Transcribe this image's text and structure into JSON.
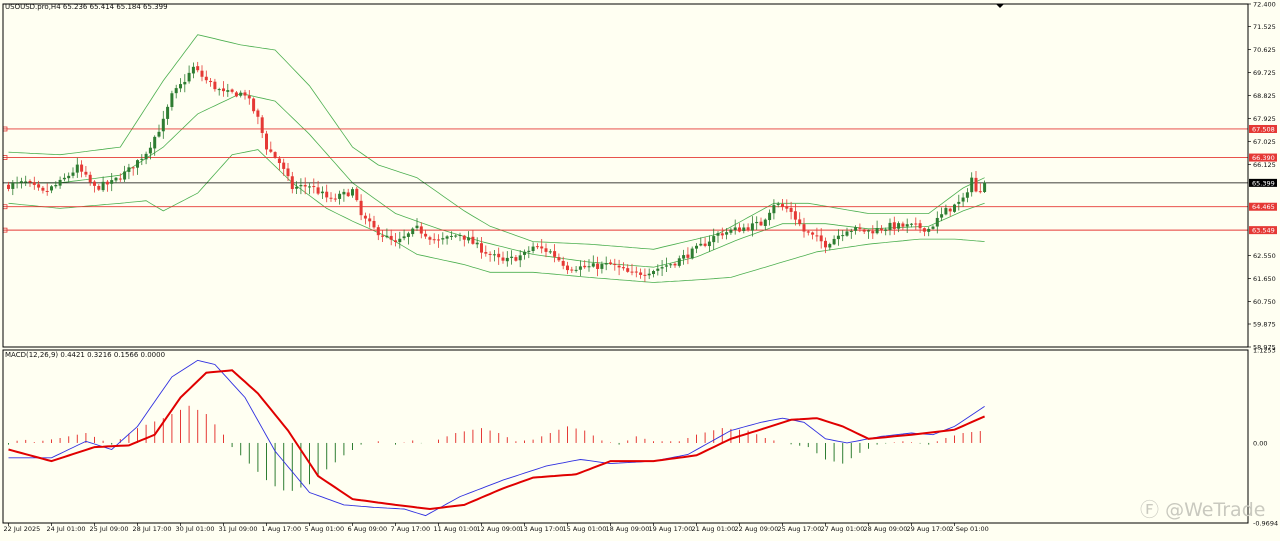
{
  "chart_data": [
    {
      "type": "candlestick",
      "title": "USOUSD.pro,H4",
      "ohlc_readout": "65.236 65.414 65.184 65.399",
      "ylim": [
        58.975,
        72.4
      ],
      "price_ticks": [
        "72.400",
        "71.525",
        "70.625",
        "69.725",
        "68.825",
        "67.925",
        "67.025",
        "66.125",
        "62.550",
        "61.650",
        "60.750",
        "59.875",
        "58.975"
      ],
      "levels": [
        {
          "value": 67.508,
          "label": "67.508"
        },
        {
          "value": 66.39,
          "label": "66.390"
        },
        {
          "value": 64.465,
          "label": "64.465"
        },
        {
          "value": 63.549,
          "label": "63.549"
        }
      ],
      "current_price": {
        "value": 65.399,
        "label": "65.399"
      },
      "date_ticks": [
        {
          "index": 0,
          "label": "22 Jul 2025"
        },
        {
          "index": 10,
          "label": "24 Jul 01:00"
        },
        {
          "index": 20,
          "label": "25 Jul 09:00"
        },
        {
          "index": 30,
          "label": "28 Jul 17:00"
        },
        {
          "index": 40,
          "label": "30 Jul 01:00"
        },
        {
          "index": 50,
          "label": "31 Jul 09:00"
        },
        {
          "index": 60,
          "label": "1 Aug 17:00"
        },
        {
          "index": 70,
          "label": "5 Aug 01:00"
        },
        {
          "index": 80,
          "label": "6 Aug 09:00"
        },
        {
          "index": 90,
          "label": "7 Aug 17:00"
        },
        {
          "index": 100,
          "label": "11 Aug 01:00"
        },
        {
          "index": 110,
          "label": "12 Aug 09:00"
        },
        {
          "index": 120,
          "label": "13 Aug 17:00"
        },
        {
          "index": 130,
          "label": "15 Aug 01:00"
        },
        {
          "index": 140,
          "label": "18 Aug 09:00"
        },
        {
          "index": 150,
          "label": "19 Aug 17:00"
        },
        {
          "index": 160,
          "label": "21 Aug 01:00"
        },
        {
          "index": 170,
          "label": "22 Aug 09:00"
        },
        {
          "index": 180,
          "label": "25 Aug 17:00"
        },
        {
          "index": 190,
          "label": "27 Aug 01:00"
        },
        {
          "index": 200,
          "label": "28 Aug 09:00"
        },
        {
          "index": 210,
          "label": "29 Aug 17:00"
        },
        {
          "index": 220,
          "label": "2 Sep 01:00"
        }
      ],
      "close_keys": [
        [
          0,
          65.3
        ],
        [
          4,
          65.4
        ],
        [
          8,
          65.0
        ],
        [
          12,
          65.4
        ],
        [
          16,
          66.0
        ],
        [
          20,
          65.2
        ],
        [
          24,
          65.4
        ],
        [
          28,
          65.9
        ],
        [
          32,
          66.6
        ],
        [
          36,
          67.8
        ],
        [
          38,
          68.8
        ],
        [
          40,
          69.2
        ],
        [
          43,
          69.9
        ],
        [
          46,
          69.4
        ],
        [
          50,
          68.9
        ],
        [
          55,
          68.9
        ],
        [
          58,
          67.9
        ],
        [
          60,
          66.8
        ],
        [
          63,
          66.2
        ],
        [
          66,
          65.2
        ],
        [
          70,
          65.3
        ],
        [
          75,
          64.7
        ],
        [
          80,
          65.1
        ],
        [
          82,
          64.1
        ],
        [
          85,
          63.6
        ],
        [
          90,
          63.0
        ],
        [
          95,
          63.6
        ],
        [
          100,
          63.1
        ],
        [
          105,
          63.4
        ],
        [
          110,
          62.8
        ],
        [
          115,
          62.3
        ],
        [
          120,
          62.6
        ],
        [
          122,
          62.9
        ],
        [
          126,
          62.7
        ],
        [
          130,
          62.1
        ],
        [
          135,
          62.1
        ],
        [
          140,
          62.2
        ],
        [
          145,
          61.8
        ],
        [
          150,
          62.0
        ],
        [
          155,
          62.3
        ],
        [
          160,
          62.8
        ],
        [
          165,
          63.4
        ],
        [
          170,
          63.6
        ],
        [
          175,
          63.8
        ],
        [
          178,
          64.6
        ],
        [
          182,
          64.3
        ],
        [
          185,
          63.5
        ],
        [
          190,
          63.0
        ],
        [
          195,
          63.6
        ],
        [
          200,
          63.5
        ],
        [
          205,
          63.7
        ],
        [
          210,
          63.7
        ],
        [
          214,
          63.6
        ],
        [
          218,
          64.3
        ],
        [
          222,
          64.7
        ],
        [
          224,
          65.6
        ],
        [
          225,
          65.0
        ],
        [
          227,
          65.399
        ]
      ],
      "bands": {
        "upper": [
          [
            0,
            66.6
          ],
          [
            12,
            66.5
          ],
          [
            26,
            66.8
          ],
          [
            36,
            69.4
          ],
          [
            44,
            71.2
          ],
          [
            54,
            70.8
          ],
          [
            62,
            70.6
          ],
          [
            70,
            69.2
          ],
          [
            80,
            66.8
          ],
          [
            86,
            66.1
          ],
          [
            95,
            65.6
          ],
          [
            106,
            64.3
          ],
          [
            112,
            63.7
          ],
          [
            122,
            63.1
          ],
          [
            135,
            63.0
          ],
          [
            150,
            62.8
          ],
          [
            165,
            63.4
          ],
          [
            178,
            64.6
          ],
          [
            186,
            64.6
          ],
          [
            200,
            64.2
          ],
          [
            214,
            64.2
          ],
          [
            222,
            65.2
          ],
          [
            227,
            65.6
          ]
        ],
        "mid": [
          [
            0,
            65.4
          ],
          [
            12,
            65.4
          ],
          [
            26,
            65.7
          ],
          [
            36,
            66.8
          ],
          [
            44,
            68.1
          ],
          [
            54,
            68.9
          ],
          [
            62,
            68.6
          ],
          [
            70,
            67.3
          ],
          [
            80,
            65.4
          ],
          [
            90,
            64.2
          ],
          [
            100,
            63.6
          ],
          [
            110,
            63.1
          ],
          [
            122,
            62.6
          ],
          [
            135,
            62.3
          ],
          [
            150,
            62.1
          ],
          [
            160,
            62.5
          ],
          [
            170,
            63.2
          ],
          [
            180,
            63.8
          ],
          [
            190,
            63.8
          ],
          [
            200,
            63.6
          ],
          [
            214,
            63.7
          ],
          [
            222,
            64.3
          ],
          [
            227,
            64.6
          ]
        ],
        "lower": [
          [
            0,
            64.6
          ],
          [
            12,
            64.4
          ],
          [
            26,
            64.6
          ],
          [
            32,
            64.7
          ],
          [
            36,
            64.3
          ],
          [
            44,
            65.0
          ],
          [
            52,
            66.5
          ],
          [
            58,
            66.7
          ],
          [
            66,
            65.4
          ],
          [
            74,
            64.4
          ],
          [
            80,
            63.9
          ],
          [
            88,
            63.3
          ],
          [
            95,
            62.6
          ],
          [
            106,
            62.2
          ],
          [
            112,
            61.9
          ],
          [
            122,
            61.9
          ],
          [
            135,
            61.7
          ],
          [
            150,
            61.5
          ],
          [
            160,
            61.6
          ],
          [
            168,
            61.7
          ],
          [
            178,
            62.2
          ],
          [
            188,
            62.7
          ],
          [
            200,
            63.0
          ],
          [
            212,
            63.2
          ],
          [
            220,
            63.2
          ],
          [
            227,
            63.1
          ]
        ]
      }
    },
    {
      "type": "line",
      "title": "MACD(12,26,9) 0.4421 0.3216 0.1566 0.0000",
      "ylim": [
        -0.9694,
        1.1253
      ],
      "y_ticks": [
        "1.1253",
        "0.00",
        "-0.9694"
      ],
      "macd_line": [
        [
          0,
          -0.18
        ],
        [
          10,
          -0.18
        ],
        [
          18,
          0.02
        ],
        [
          24,
          -0.08
        ],
        [
          30,
          0.2
        ],
        [
          38,
          0.8
        ],
        [
          44,
          1.0
        ],
        [
          48,
          0.95
        ],
        [
          55,
          0.55
        ],
        [
          62,
          -0.1
        ],
        [
          70,
          -0.6
        ],
        [
          78,
          -0.75
        ],
        [
          85,
          -0.78
        ],
        [
          92,
          -0.8
        ],
        [
          97,
          -0.88
        ],
        [
          105,
          -0.65
        ],
        [
          115,
          -0.45
        ],
        [
          125,
          -0.28
        ],
        [
          133,
          -0.2
        ],
        [
          140,
          -0.25
        ],
        [
          150,
          -0.22
        ],
        [
          158,
          -0.14
        ],
        [
          168,
          0.15
        ],
        [
          175,
          0.25
        ],
        [
          180,
          0.3
        ],
        [
          185,
          0.25
        ],
        [
          190,
          0.05
        ],
        [
          195,
          0.0
        ],
        [
          203,
          0.08
        ],
        [
          210,
          0.12
        ],
        [
          215,
          0.1
        ],
        [
          220,
          0.2
        ],
        [
          227,
          0.4421
        ]
      ],
      "signal_line": [
        [
          0,
          -0.08
        ],
        [
          10,
          -0.22
        ],
        [
          20,
          -0.05
        ],
        [
          28,
          -0.03
        ],
        [
          34,
          0.1
        ],
        [
          40,
          0.55
        ],
        [
          46,
          0.85
        ],
        [
          52,
          0.88
        ],
        [
          58,
          0.6
        ],
        [
          65,
          0.15
        ],
        [
          72,
          -0.4
        ],
        [
          80,
          -0.68
        ],
        [
          90,
          -0.75
        ],
        [
          98,
          -0.8
        ],
        [
          106,
          -0.75
        ],
        [
          115,
          -0.55
        ],
        [
          122,
          -0.42
        ],
        [
          132,
          -0.38
        ],
        [
          140,
          -0.22
        ],
        [
          150,
          -0.22
        ],
        [
          160,
          -0.15
        ],
        [
          168,
          0.05
        ],
        [
          176,
          0.18
        ],
        [
          182,
          0.28
        ],
        [
          188,
          0.3
        ],
        [
          194,
          0.2
        ],
        [
          200,
          0.05
        ],
        [
          210,
          0.1
        ],
        [
          220,
          0.16
        ],
        [
          227,
          0.3216
        ]
      ],
      "histogram_keys": [
        [
          0,
          -0.02
        ],
        [
          3,
          0.05
        ],
        [
          6,
          0.01
        ],
        [
          12,
          0.06
        ],
        [
          18,
          0.12
        ],
        [
          24,
          -0.02
        ],
        [
          30,
          0.18
        ],
        [
          36,
          0.3
        ],
        [
          42,
          0.45
        ],
        [
          46,
          0.35
        ],
        [
          50,
          0.1
        ],
        [
          52,
          -0.05
        ],
        [
          56,
          -0.25
        ],
        [
          61,
          -0.5
        ],
        [
          65,
          -0.6
        ],
        [
          70,
          -0.5
        ],
        [
          74,
          -0.32
        ],
        [
          78,
          -0.15
        ],
        [
          82,
          -0.02
        ],
        [
          86,
          0.02
        ],
        [
          90,
          -0.02
        ],
        [
          94,
          0.03
        ],
        [
          97,
          -0.02
        ],
        [
          100,
          0.04
        ],
        [
          104,
          0.12
        ],
        [
          110,
          0.18
        ],
        [
          114,
          0.12
        ],
        [
          118,
          0.02
        ],
        [
          122,
          0.04
        ],
        [
          126,
          0.12
        ],
        [
          130,
          0.2
        ],
        [
          134,
          0.15
        ],
        [
          138,
          0.03
        ],
        [
          142,
          -0.02
        ],
        [
          146,
          0.08
        ],
        [
          150,
          0.02
        ],
        [
          156,
          0.02
        ],
        [
          160,
          0.1
        ],
        [
          166,
          0.18
        ],
        [
          172,
          0.15
        ],
        [
          176,
          0.06
        ],
        [
          180,
          0.0
        ],
        [
          186,
          -0.05
        ],
        [
          190,
          -0.2
        ],
        [
          194,
          -0.25
        ],
        [
          198,
          -0.12
        ],
        [
          202,
          -0.02
        ],
        [
          208,
          0.02
        ],
        [
          214,
          -0.02
        ],
        [
          218,
          0.06
        ],
        [
          222,
          0.12
        ],
        [
          227,
          0.15
        ]
      ]
    }
  ],
  "watermark": "@WeTrade",
  "colors": {
    "background": "#fffff2",
    "bull": "#2e7d32",
    "bear": "#e53935",
    "band": "#4caf50",
    "level": "#e53935",
    "macd": "#3030e0",
    "signal": "#e00000"
  }
}
